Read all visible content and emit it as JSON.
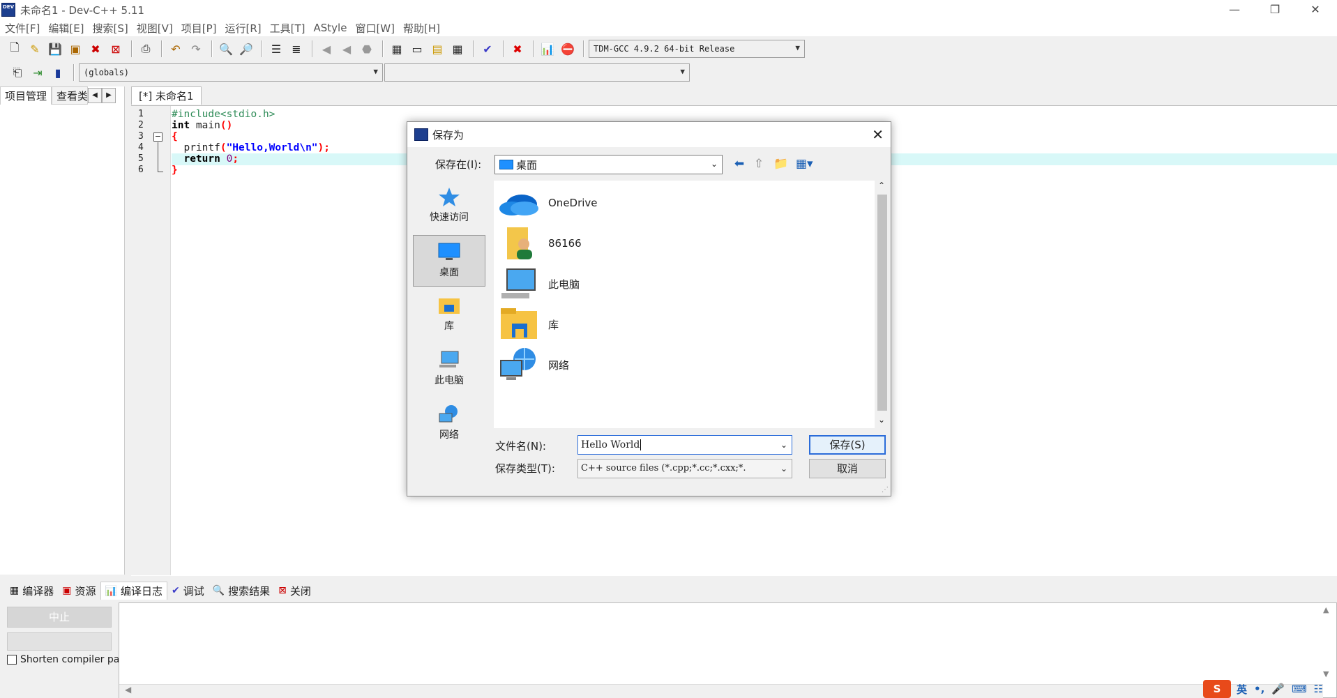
{
  "window": {
    "title": "未命名1 - Dev-C++ 5.11",
    "app_icon_text": "DEV"
  },
  "menu": [
    "文件[F]",
    "编辑[E]",
    "搜索[S]",
    "视图[V]",
    "项目[P]",
    "运行[R]",
    "工具[T]",
    "AStyle",
    "窗口[W]",
    "帮助[H]"
  ],
  "toolbar": {
    "compiler_select": "TDM-GCC 4.9.2 64-bit Release",
    "scope_select": "(globals)",
    "symbol_select": ""
  },
  "left_tabs": {
    "project": "项目管理",
    "classes": "查看类"
  },
  "editor": {
    "tab": "[*] 未命名1",
    "line_numbers": [
      "1",
      "2",
      "3",
      "4",
      "5",
      "6"
    ],
    "lines": {
      "l1_pp": "#include<stdio.h>",
      "l2_kw": "int",
      "l2_rest": " main",
      "l2_paren": "()",
      "l3_brace": "{",
      "l4_fn": "  printf",
      "l4_open": "(",
      "l4_str": "\"Hello,World\\n\"",
      "l4_close": ");",
      "l5_kw": "  return",
      "l5_num": " 0",
      "l5_semi": ";",
      "l6_brace": "}"
    }
  },
  "bottom_tabs": [
    "编译器",
    "资源",
    "编译日志",
    "调试",
    "搜索结果",
    "关闭"
  ],
  "bottom": {
    "abort": "中止",
    "shorten": "Shorten compiler pa"
  },
  "ime": {
    "logo": "S",
    "mode": "英",
    "punct": "•,",
    "mic": "🎤",
    "kbd": "⌨",
    "grid": "☷"
  },
  "dialog": {
    "title": "保存为",
    "save_in_label": "保存在(I):",
    "save_in_value": "桌面",
    "places": [
      "快速访问",
      "桌面",
      "库",
      "此电脑",
      "网络"
    ],
    "files": [
      "OneDrive",
      "86166",
      "此电脑",
      "库",
      "网络"
    ],
    "filename_label": "文件名(N):",
    "filename_value": "Hello World",
    "filetype_label": "保存类型(T):",
    "filetype_value": "C++ source files (*.cpp;*.cc;*.cxx;*.",
    "save_button": "保存(S)",
    "cancel_button": "取消"
  }
}
